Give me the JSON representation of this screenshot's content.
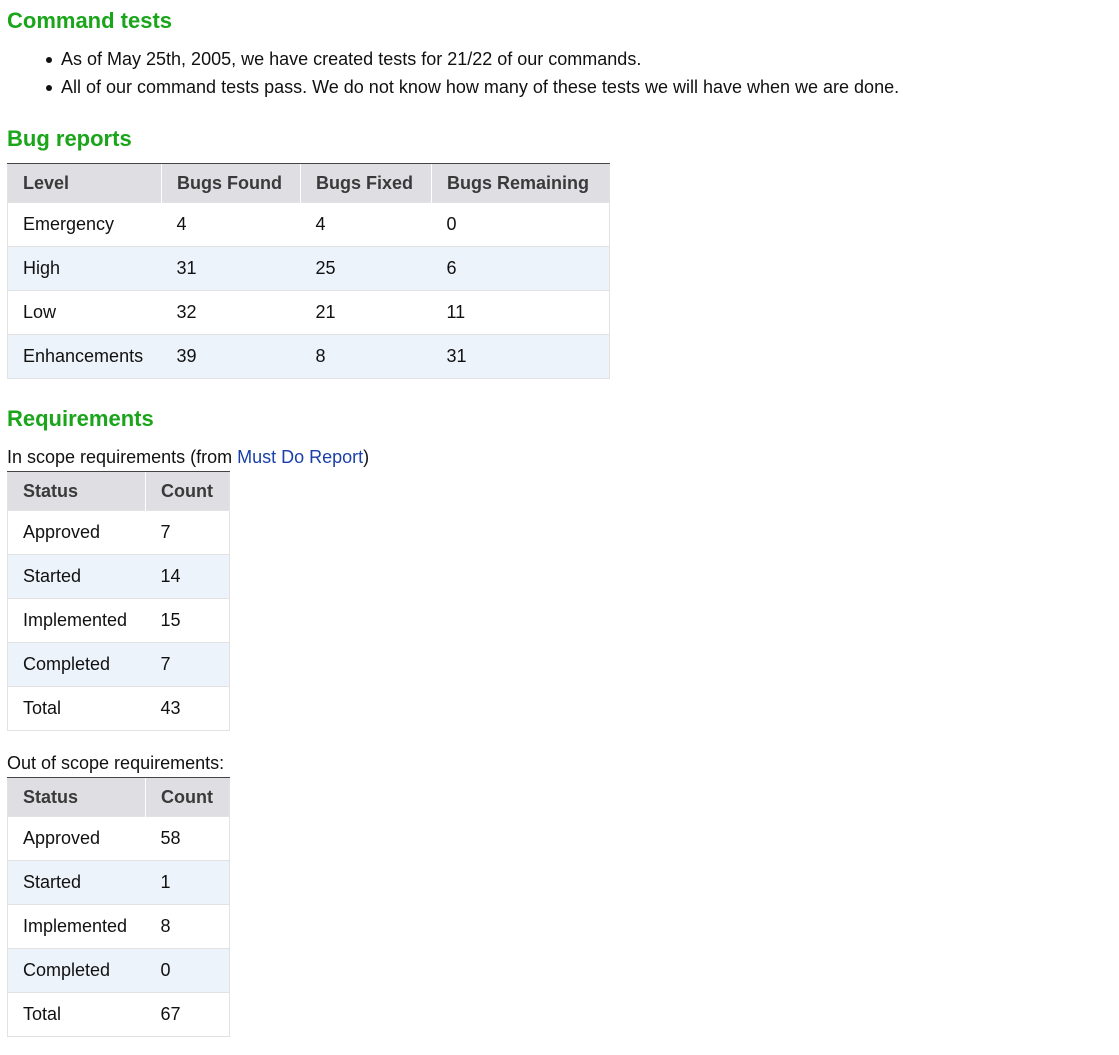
{
  "command_tests": {
    "heading": "Command tests",
    "bullets": [
      "As of May 25th, 2005, we have created tests for 21/22 of our commands.",
      "All of our command tests pass. We do not know how many of these tests we will have when we are done."
    ]
  },
  "bug_reports": {
    "heading": "Bug reports",
    "columns": [
      "Level",
      "Bugs Found",
      "Bugs Fixed",
      "Bugs Remaining"
    ],
    "rows": [
      [
        "Emergency",
        "4",
        "4",
        "0"
      ],
      [
        "High",
        "31",
        "25",
        "6"
      ],
      [
        "Low",
        "32",
        "21",
        "11"
      ],
      [
        "Enhancements",
        "39",
        "8",
        "31"
      ]
    ]
  },
  "requirements": {
    "heading": "Requirements",
    "in_scope": {
      "caption_prefix": "In scope requirements (from ",
      "link_text": "Must Do Report",
      "caption_suffix": ")",
      "columns": [
        "Status",
        "Count"
      ],
      "rows": [
        [
          "Approved",
          "7"
        ],
        [
          "Started",
          "14"
        ],
        [
          "Implemented",
          "15"
        ],
        [
          "Completed",
          "7"
        ],
        [
          "Total",
          "43"
        ]
      ]
    },
    "out_of_scope": {
      "caption": "Out of scope requirements:",
      "columns": [
        "Status",
        "Count"
      ],
      "rows": [
        [
          "Approved",
          "58"
        ],
        [
          "Started",
          "1"
        ],
        [
          "Implemented",
          "8"
        ],
        [
          "Completed",
          "0"
        ],
        [
          "Total",
          "67"
        ]
      ]
    }
  },
  "colors": {
    "heading": "#1aa51a",
    "link": "#1a3faa",
    "table_header_bg": "#dfdfe3",
    "table_alt_row_bg": "#edf3fa"
  }
}
